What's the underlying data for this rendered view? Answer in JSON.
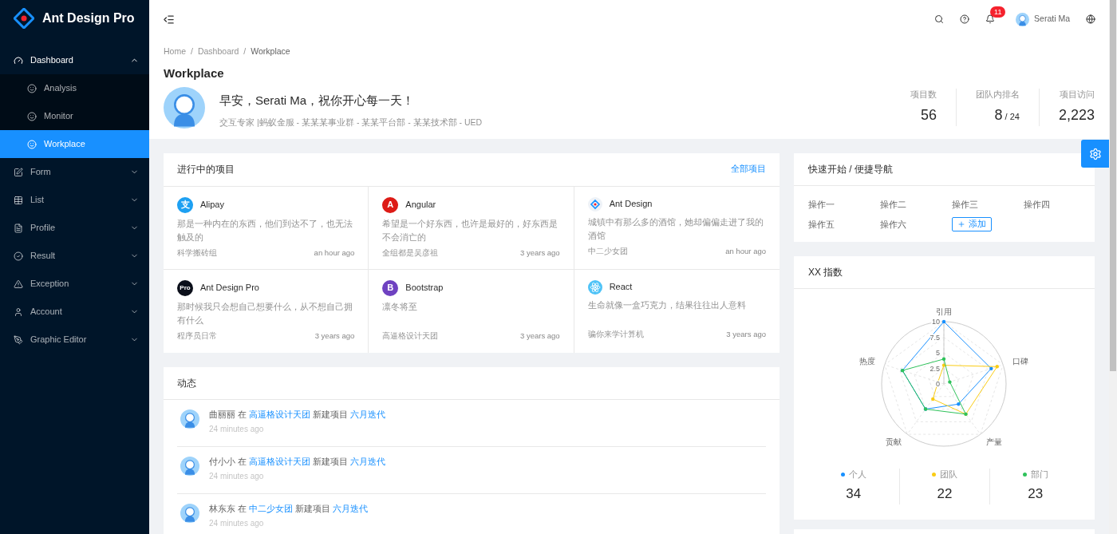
{
  "sidebar": {
    "logo_text": "Ant Design Pro",
    "items": [
      {
        "label": "Dashboard",
        "expanded": true,
        "children": [
          {
            "label": "Analysis",
            "selected": false
          },
          {
            "label": "Monitor",
            "selected": false
          },
          {
            "label": "Workplace",
            "selected": true
          }
        ]
      },
      {
        "label": "Form",
        "expanded": false
      },
      {
        "label": "List",
        "expanded": false
      },
      {
        "label": "Profile",
        "expanded": false
      },
      {
        "label": "Result",
        "expanded": false
      },
      {
        "label": "Exception",
        "expanded": false
      },
      {
        "label": "Account",
        "expanded": false
      },
      {
        "label": "Graphic Editor",
        "expanded": false
      }
    ]
  },
  "header": {
    "notification_count": "11",
    "user_name": "Serati Ma"
  },
  "page_header": {
    "breadcrumb": [
      "Home",
      "Dashboard",
      "Workplace"
    ],
    "breadcrumb_separator": "/",
    "title": "Workplace",
    "greeting": "早安，Serati Ma，祝你开心每一天！",
    "subtitle": "交互专家 |蚂蚁金服 - 某某某事业群 - 某某平台部 - 某某技术部 - UED",
    "stats": [
      {
        "label": "项目数",
        "value": "56"
      },
      {
        "label": "团队内排名",
        "value": "8",
        "suffix": "/ 24"
      },
      {
        "label": "项目访问",
        "value": "2,223"
      }
    ]
  },
  "projects": {
    "title": "进行中的项目",
    "link": "全部项目",
    "items": [
      {
        "name": "Alipay",
        "logo": {
          "kind": "letter",
          "text": "支",
          "color": "#1da0f2"
        },
        "description": "那是一种内在的东西，他们到达不了，也无法触及的",
        "group": "科学搬砖组",
        "time": "an hour ago"
      },
      {
        "name": "Angular",
        "logo": {
          "kind": "letter",
          "text": "A",
          "color": "#dd1b16"
        },
        "description": "希望是一个好东西，也许是最好的，好东西是不会消亡的",
        "group": "全组都是吴彦祖",
        "time": "3 years ago"
      },
      {
        "name": "Ant Design",
        "logo": {
          "kind": "antd"
        },
        "description": "城镇中有那么多的酒馆，她却偏偏走进了我的酒馆",
        "group": "中二少女团",
        "time": "an hour ago"
      },
      {
        "name": "Ant Design Pro",
        "logo": {
          "kind": "letter",
          "text": "Pro",
          "color": "#0b0f1a"
        },
        "description": "那时候我只会想自己想要什么，从不想自己拥有什么",
        "group": "程序员日常",
        "time": "3 years ago"
      },
      {
        "name": "Bootstrap",
        "logo": {
          "kind": "letter",
          "text": "B",
          "color": "#6f42c1"
        },
        "description": "凛冬将至",
        "group": "高逼格设计天团",
        "time": "3 years ago"
      },
      {
        "name": "React",
        "logo": {
          "kind": "react"
        },
        "description": "生命就像一盒巧克力，结果往往出人意料",
        "group": "骗你来学计算机",
        "time": "3 years ago"
      }
    ]
  },
  "activity": {
    "title": "动态",
    "items": [
      {
        "user": "曲丽丽",
        "verb": "在",
        "group": "高逼格设计天团",
        "action": "新建项目",
        "project": "六月迭代",
        "time": "24 minutes ago"
      },
      {
        "user": "付小小",
        "verb": "在",
        "group": "高逼格设计天团",
        "action": "新建项目",
        "project": "六月迭代",
        "time": "24 minutes ago"
      },
      {
        "user": "林东东",
        "verb": "在",
        "group": "中二少女团",
        "action": "新建项目",
        "project": "六月迭代",
        "time": "24 minutes ago"
      }
    ]
  },
  "quick_start": {
    "title": "快速开始 / 便捷导航",
    "links": [
      "操作一",
      "操作二",
      "操作三",
      "操作四",
      "操作五",
      "操作六"
    ],
    "add_button": "添加"
  },
  "index_card": {
    "title": "XX 指数",
    "chart_data": {
      "type": "radar",
      "categories": [
        "引用",
        "口碑",
        "产量",
        "贡献",
        "热度"
      ],
      "yticks": [
        0,
        2.5,
        5,
        7.5,
        10
      ],
      "ylim": [
        0,
        10
      ],
      "series": [
        {
          "name": "个人",
          "color": "#1890ff",
          "values": [
            10,
            8,
            4,
            5,
            7
          ]
        },
        {
          "name": "团队",
          "color": "#facc14",
          "values": [
            3,
            9,
            6,
            3,
            1
          ]
        },
        {
          "name": "部门",
          "color": "#2fc25b",
          "values": [
            4,
            1,
            6,
            5,
            7
          ]
        }
      ]
    },
    "legend_values": [
      "34",
      "22",
      "23"
    ]
  }
}
